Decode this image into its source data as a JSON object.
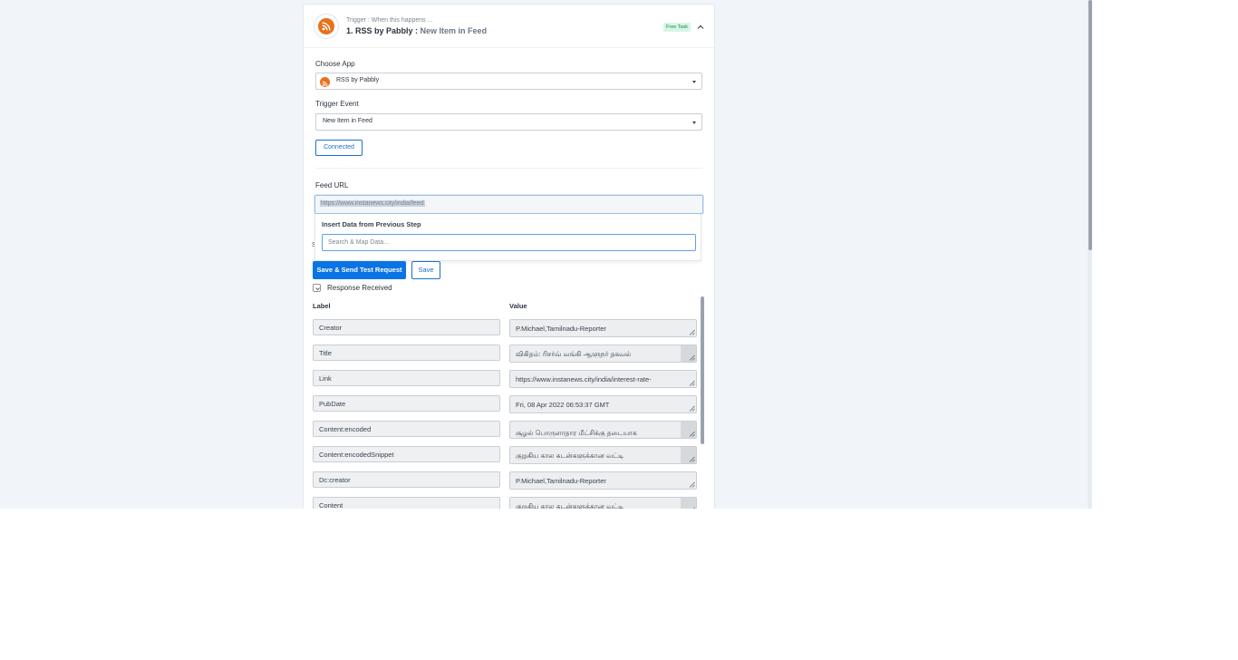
{
  "header": {
    "caption": "Trigger : When this happens ...",
    "title": "1. RSS by Pabbly :",
    "event": "New Item in Feed",
    "badge": "Free Task",
    "app_icon": "rss-icon",
    "collapse_icon": "chevron-up-icon"
  },
  "choose_app": {
    "label": "Choose App",
    "value": "RSS by Pabbly"
  },
  "trigger_event": {
    "label": "Trigger Event",
    "value": "New Item in Feed"
  },
  "connection": {
    "button_label": "Connected"
  },
  "feed_url": {
    "label": "Feed URL",
    "value": "https://www.instanews.city/india/feed"
  },
  "map_panel": {
    "title": "Insert Data from Previous Step",
    "search_placeholder": "Search & Map Data..."
  },
  "actions": {
    "send_test_label": "Save & Send Test Request",
    "save_label": "Save"
  },
  "response": {
    "label": "Response Received",
    "col_label": "Label",
    "col_value": "Value",
    "rows": [
      {
        "label": "Creator",
        "value": "P.Michael,Tamilnadu-Reporter"
      },
      {
        "label": "Title",
        "value": "விகிதம்: ரிசர்வ் வங்கி ஆளுநர் தகவல்"
      },
      {
        "label": "Link",
        "value": "https://www.instanews.city/india/interest-rate-"
      },
      {
        "label": "PubDate",
        "value": "Fri, 08 Apr 2022 06:53:37 GMT"
      },
      {
        "label": "Content:encoded",
        "value": "சூழல் பொருளாதார மீட்சிக்கு தடையாக"
      },
      {
        "label": "Content:encodedSnippet",
        "value": "குறுகிய கால கடன்களுக்கான வட்டி"
      },
      {
        "label": "Dc:creator",
        "value": "P.Michael,Tamilnadu-Reporter"
      },
      {
        "label": "Content",
        "value": "குறுகிய கால கடன்களுக்கான வட்டி"
      }
    ]
  },
  "colors": {
    "accent": "#0b74e5",
    "rss_orange": "#e8711c",
    "badge_bg": "#d7f6e5",
    "badge_text": "#1d8a4f"
  }
}
